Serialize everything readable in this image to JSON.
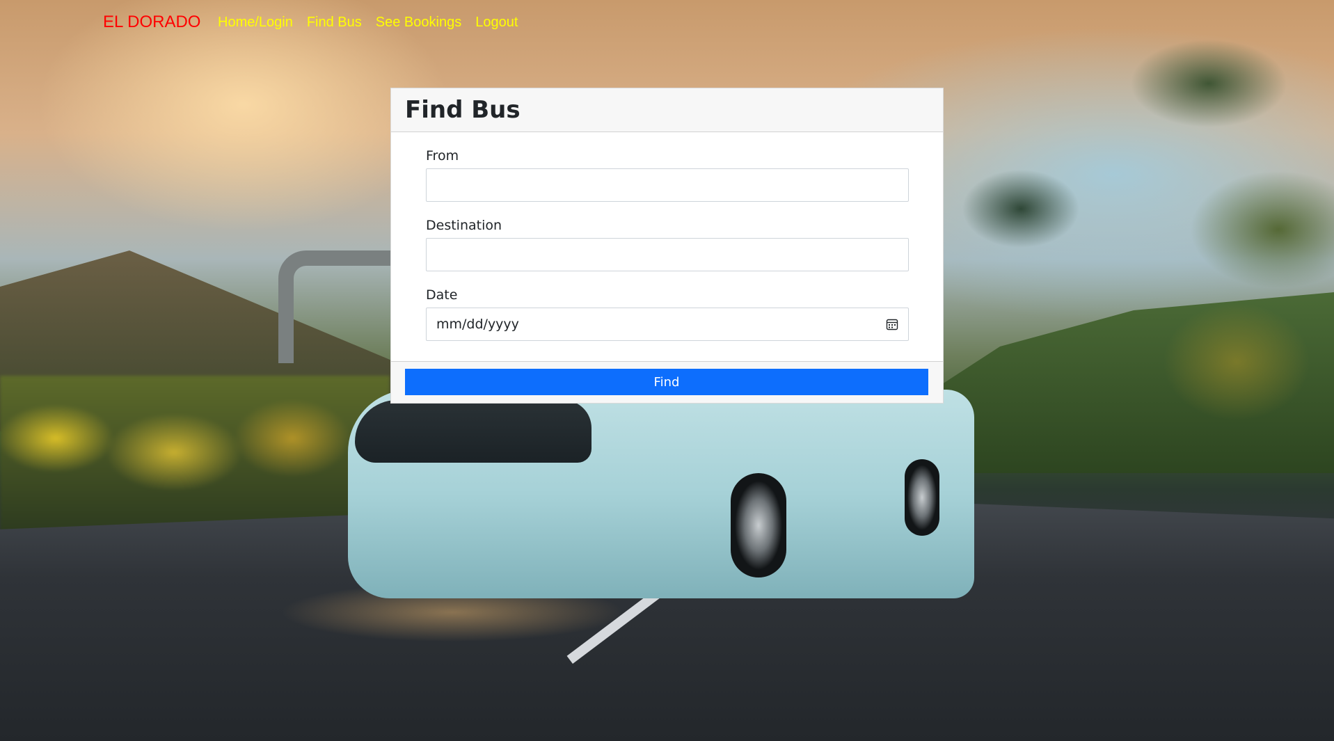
{
  "navbar": {
    "brand": "EL DORADO",
    "links": [
      {
        "label": "Home/Login"
      },
      {
        "label": "Find Bus"
      },
      {
        "label": "See Bookings"
      },
      {
        "label": "Logout"
      }
    ],
    "colors": {
      "brand": "#ff0000",
      "links": "#ffff00"
    }
  },
  "card": {
    "title": "Find Bus",
    "fields": {
      "from": {
        "label": "From",
        "value": ""
      },
      "destination": {
        "label": "Destination",
        "value": ""
      },
      "date": {
        "label": "Date",
        "placeholder": "mm/dd/yyyy",
        "icon": "calendar-icon"
      }
    },
    "submit_label": "Find",
    "accent_color": "#0d6efd"
  }
}
